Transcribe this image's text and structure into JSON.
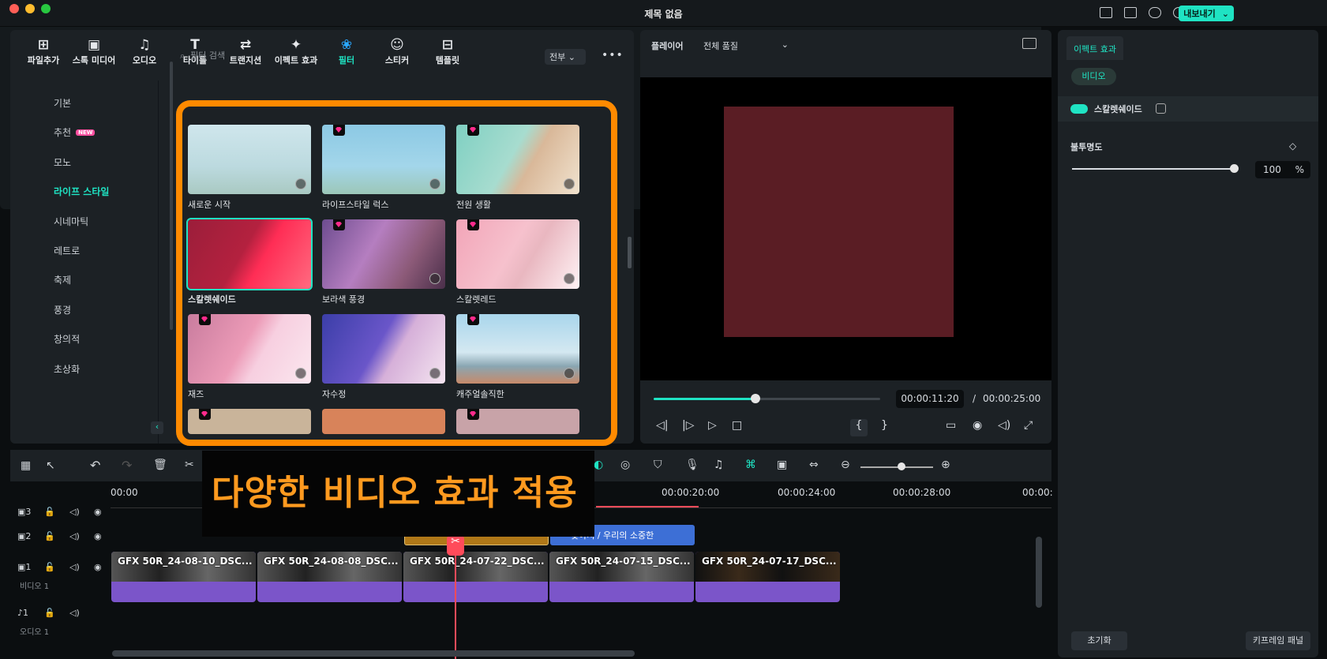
{
  "window": {
    "title": "제목 없음",
    "export_label": "내보내기"
  },
  "media_toolbar": [
    {
      "label": "파일추가",
      "icon": "import-icon"
    },
    {
      "label": "스톡 미디어",
      "icon": "stock-media-icon"
    },
    {
      "label": "오디오",
      "icon": "music-icon"
    },
    {
      "label": "타이틀",
      "icon": "title-icon"
    },
    {
      "label": "트랜지션",
      "icon": "transition-icon"
    },
    {
      "label": "이펙트 효과",
      "icon": "effects-icon"
    },
    {
      "label": "필터",
      "icon": "filter-icon",
      "active": true
    },
    {
      "label": "스티커",
      "icon": "sticker-icon"
    },
    {
      "label": "템플릿",
      "icon": "template-icon"
    }
  ],
  "categories": [
    "기본",
    "추천",
    "모노",
    "라이프 스타일",
    "시네마틱",
    "레트로",
    "축제",
    "풍경",
    "창의적",
    "초상화"
  ],
  "new_badge": "NEW",
  "search": {
    "placeholder": "필터 검색",
    "scope": "전부"
  },
  "filters": [
    {
      "label": "새로운 시작"
    },
    {
      "label": "라이프스타일 럭스"
    },
    {
      "label": "전원 생활"
    },
    {
      "label": "스칼렛쉐이드"
    },
    {
      "label": "보라색 풍경"
    },
    {
      "label": "스칼렛레드"
    },
    {
      "label": "재즈"
    },
    {
      "label": "자수정"
    },
    {
      "label": "캐주얼솔직한"
    }
  ],
  "player": {
    "tab": "플레이어",
    "quality": "전체 품질",
    "current_time": "00:00:11:20",
    "duration": "00:00:25:00",
    "progress": 0.45
  },
  "properties": {
    "tab": "이펙트 효과",
    "pill": "비디오",
    "effect_name": "스칼렛쉐이드",
    "opacity_label": "불투명도",
    "opacity_value": "100",
    "opacity_unit": "%",
    "reset": "초기화",
    "keyframe": "키프레임 패널"
  },
  "timeline": {
    "ruler": [
      "00:00",
      "00:00:20:00",
      "00:00:24:00",
      "00:00:28:00",
      "00:00:"
    ],
    "tracks": [
      {
        "num": "3"
      },
      {
        "num": "2"
      },
      {
        "num": "1",
        "label": "비디오 1"
      },
      {
        "num": "1",
        "label": "오디오 1"
      }
    ],
    "title_clip": "찾아서 / 우리의 소중한",
    "clips": [
      "GFX 50R_24-08-10_DSC...",
      "GFX 50R_24-08-08_DSC...",
      "GFX 50R_24-07-22_DSC...",
      "GFX 50R_24-07-15_DSC...",
      "GFX 50R_24-07-17_DSC..."
    ]
  },
  "caption": "다양한 비디오 효과 적용",
  "colors": {
    "accent": "#1fe3c3",
    "highlight": "#ff8a00",
    "clip": "#7b55c9"
  }
}
